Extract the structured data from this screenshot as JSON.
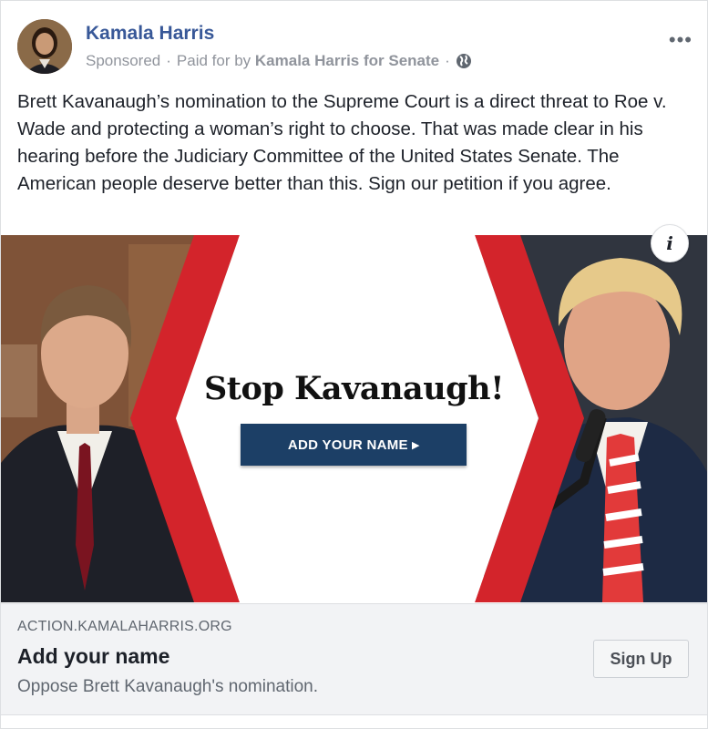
{
  "post": {
    "author_name": "Kamala Harris",
    "sponsored_label": "Sponsored",
    "paid_prefix": "Paid for by",
    "paid_by": "Kamala Harris for Senate",
    "separator": "·",
    "more_label": "•••",
    "audience_icon": "globe-icon",
    "body": "Brett Kavanaugh’s nomination to the Supreme Court is a direct threat to Roe v. Wade and protecting a woman’s right to choose. That was made clear in his hearing before the Judiciary Committee of the United States Senate. The American people deserve better than this. Sign our petition if you agree."
  },
  "media": {
    "headline": "Stop Kavanaugh!",
    "cta_text": "ADD YOUR NAME ▸",
    "info_label": "i"
  },
  "link": {
    "domain": "ACTION.KAMALAHARRIS.ORG",
    "title": "Add your name",
    "description": "Oppose Brett Kavanaugh's nomination.",
    "button_label": "Sign Up"
  },
  "colors": {
    "name_blue": "#385898",
    "accent_red": "#d3242b",
    "cta_navy": "#1c3f66"
  }
}
